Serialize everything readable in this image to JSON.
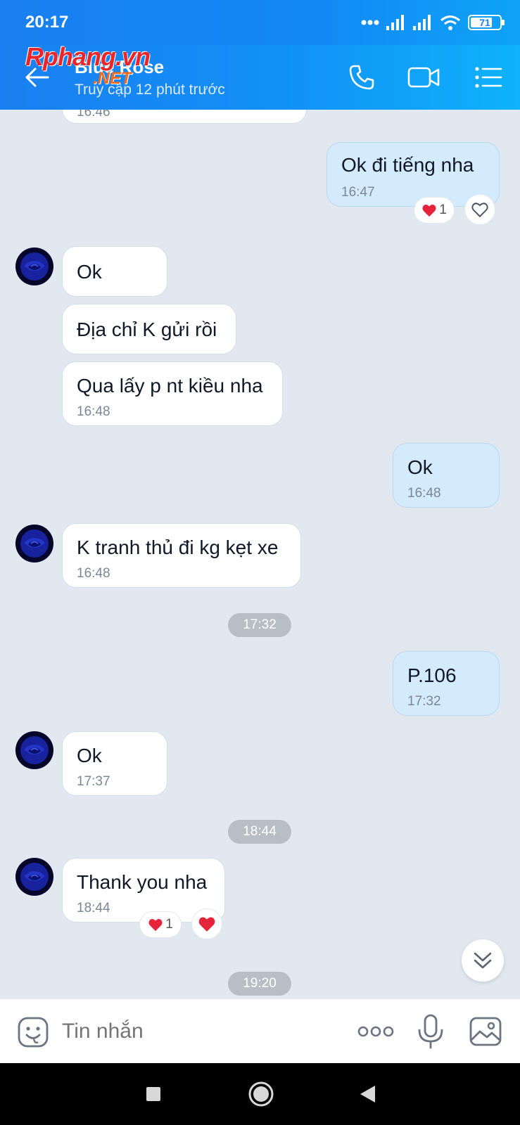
{
  "status_bar": {
    "time": "20:17",
    "battery": "71"
  },
  "header": {
    "contact_name": "Blue Rose",
    "contact_status": "Truy cập 12 phút trước",
    "watermark": "Rphang.vn",
    "watermark_net": ".NET"
  },
  "messages": [
    {
      "dir": "in",
      "time": "16:46"
    },
    {
      "dir": "out",
      "text": "Ok đi tiếng nha",
      "time": "16:47",
      "reaction_count": "1"
    },
    {
      "dir": "in",
      "text": "Ok"
    },
    {
      "dir": "in",
      "text": "Địa chỉ K gửi rồi"
    },
    {
      "dir": "in",
      "text": "Qua lấy p nt kiều nha",
      "time": "16:48"
    },
    {
      "dir": "out",
      "text": "Ok",
      "time": "16:48"
    },
    {
      "dir": "in",
      "text": "K tranh thủ đi kg kẹt xe",
      "time": "16:48"
    },
    {
      "dir": "out",
      "text": "P.106",
      "time": "17:32"
    },
    {
      "dir": "in",
      "text": "Ok",
      "time": "17:37"
    },
    {
      "dir": "in",
      "text": "Thank you nha",
      "time": "18:44",
      "reaction_count": "1"
    }
  ],
  "time_separators": [
    "17:32",
    "18:44",
    "19:20"
  ],
  "composer": {
    "placeholder": "Tin nhắn"
  },
  "colors": {
    "header_blue": "#1a7ff0",
    "outgoing_bubble": "#d4eafd",
    "chat_bg": "#e2e8f0",
    "heart": "#e5243b"
  },
  "icons": [
    "back-arrow-icon",
    "phone-icon",
    "video-call-icon",
    "menu-list-icon",
    "heart-icon",
    "chevron-double-down-icon",
    "sticker-icon",
    "more-icon",
    "microphone-icon",
    "gallery-icon",
    "square-icon",
    "circle-home-icon",
    "triangle-back-icon"
  ]
}
